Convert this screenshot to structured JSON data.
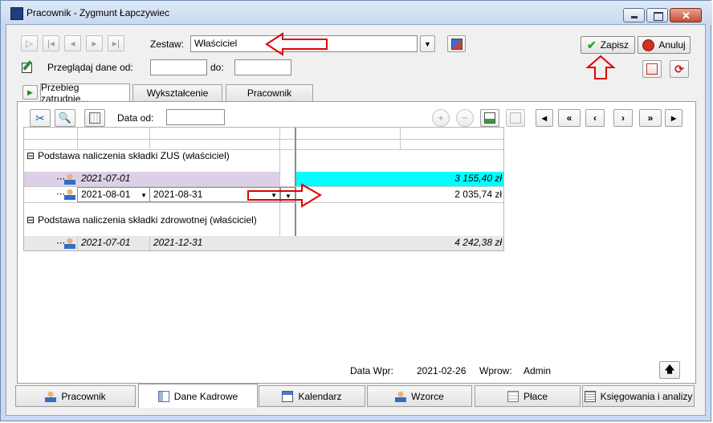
{
  "window": {
    "title": "Pracownik - Zygmunt Łapczywiec",
    "controls": [
      "minimize-icon",
      "maximize-icon",
      "close-icon"
    ]
  },
  "toolbar": {
    "zestaw_label": "Zestaw:",
    "zestaw_value": "Właściciel",
    "save_label": "Zapisz",
    "cancel_label": "Anuluj",
    "przegladaj_label": "Przeglądaj dane od:",
    "do_label": "do:",
    "przegladaj_od_value": "",
    "przegladaj_do_value": ""
  },
  "top_tabs": [
    {
      "label": "Przebieg zatrudnie...",
      "active": true
    },
    {
      "label": "Wykształcenie",
      "active": false
    },
    {
      "label": "Pracownik",
      "active": false
    }
  ],
  "grid_toolbar": {
    "data_od_label": "Data od:",
    "data_od_value": "",
    "nav_buttons": [
      "|<",
      "<<",
      "<",
      ">",
      ">>",
      ">|"
    ]
  },
  "grid": {
    "groups": [
      {
        "title": "Podstawa naliczenia składki ZUS (właściciel)",
        "rows": [
          {
            "from": "2021-07-01",
            "to": "",
            "value": "3 155,40 zł",
            "highlight": true
          },
          {
            "from": "2021-08-01",
            "to": "2021-08-31",
            "value": "2 035,74 zł",
            "editing": true
          }
        ]
      },
      {
        "title": "Podstawa naliczenia składki zdrowotnej (właściciel)",
        "rows": [
          {
            "from": "2021-07-01",
            "to": "2021-12-31",
            "value": "4 242,38 zł"
          }
        ]
      }
    ]
  },
  "status": {
    "data_wpr_label": "Data Wpr:",
    "data_wpr_value": "2021-02-26",
    "wprow_label": "Wprow:",
    "wprow_value": "Admin"
  },
  "bottom_tabs": [
    {
      "label": "Pracownik",
      "icon": "person-icon",
      "active": false
    },
    {
      "label": "Dane Kadrowe",
      "icon": "id-card-icon",
      "active": true
    },
    {
      "label": "Kalendarz",
      "icon": "calendar-icon",
      "active": false
    },
    {
      "label": "Wzorce",
      "icon": "people-icon",
      "active": false
    },
    {
      "label": "Płace",
      "icon": "calculator-icon",
      "active": false
    },
    {
      "label": "Księgowania i analizy",
      "icon": "ledger-icon",
      "active": false
    }
  ],
  "colors": {
    "highlight_row": "#dcd0e6",
    "highlight_cell": "#00ffff",
    "annotation_red": "#e00000",
    "save_check": "#2e9d2e",
    "cancel_red": "#d03020"
  }
}
